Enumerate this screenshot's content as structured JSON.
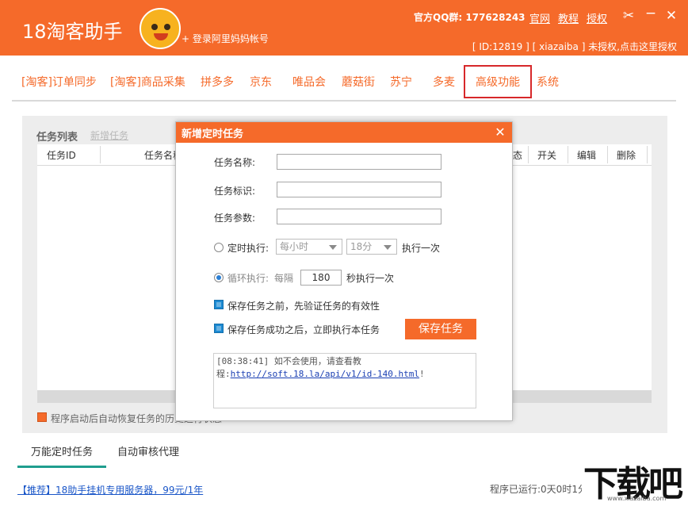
{
  "header": {
    "app_title": "18淘客助手",
    "login_link": "+ 登录阿里妈妈帐号",
    "qq_group": "官方QQ群: 177628243",
    "links": [
      "官网",
      "教程",
      "授权"
    ],
    "window_icons": [
      "tools-icon",
      "minimize-icon",
      "close-icon"
    ],
    "status_line": "[ ID:12819 ] [ xiazaiba ] 未授权,点击这里授权"
  },
  "nav": {
    "items": [
      "[淘客]订单同步",
      "[淘客]商品采集",
      "拼多多",
      "京东",
      "唯品会",
      "蘑菇街",
      "苏宁",
      "多麦",
      "高级功能",
      "系统"
    ],
    "selected": "高级功能"
  },
  "task_panel": {
    "title": "任务列表",
    "add_task": "新增任务",
    "columns_visible": [
      "任务ID",
      "任务名称",
      "态",
      "开关",
      "编辑",
      "删除"
    ],
    "restore_label": "程序启动后自动恢复任务的历史运行状态"
  },
  "dialog": {
    "title": "新增定时任务",
    "fields": {
      "name_label": "任务名称:",
      "tag_label": "任务标识:",
      "params_label": "任务参数:"
    },
    "timed": {
      "label": "定时执行:",
      "hour_select": "每小时",
      "minute_select": "18分",
      "suffix": "执行一次"
    },
    "loop": {
      "label": "循环执行:",
      "every": "每隔",
      "value": "180",
      "suffix": "秒执行一次"
    },
    "check_validate": "保存任务之前，先验证任务的有效性",
    "check_run_after": "保存任务成功之后，立即执行本任务",
    "save_button": "保存任务",
    "log": {
      "prefix": "[08:38:41] 如不会使用，请查看教程:",
      "url": "http://soft.18.la/api/v1/id-140.html",
      "suffix": "!"
    }
  },
  "bottom_tabs": [
    "万能定时任务",
    "自动审核代理"
  ],
  "footer": {
    "promo": "【推荐】18助手挂机专用服务器，99元/1年",
    "runtime": "程序已运行:0天0时1分"
  },
  "watermark": {
    "brand": "下载吧",
    "url": "www.xiazaiba.com"
  },
  "colors": {
    "accent": "#f56a2a",
    "highlight_box": "#d7282a",
    "tab_underline": "#1f9e8f",
    "checkbox": "#1b8ad3",
    "link": "#1a56c8"
  }
}
